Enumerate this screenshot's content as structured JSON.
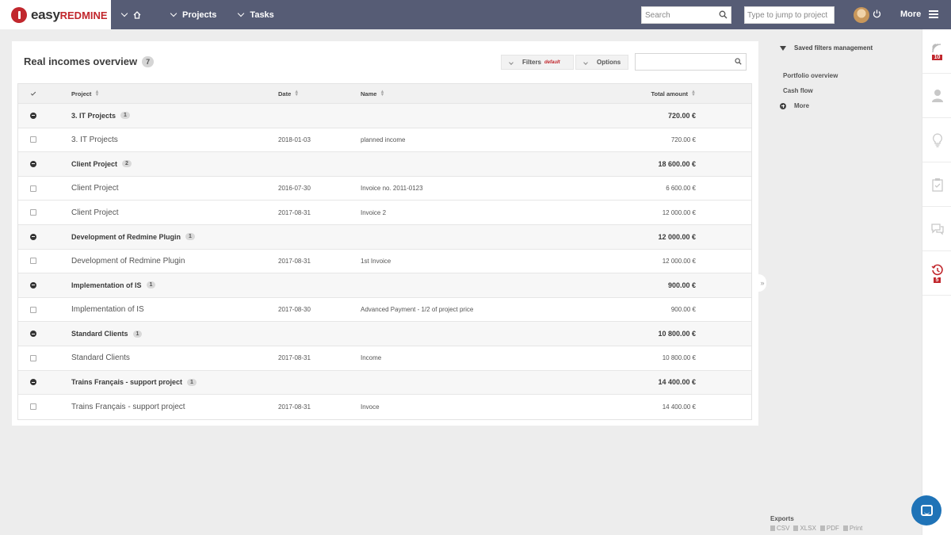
{
  "topbar": {
    "logo_easy": "easy",
    "logo_redmine": "REDMINE",
    "nav_projects": "Projects",
    "nav_tasks": "Tasks",
    "search_placeholder": "Search",
    "jump_placeholder": "Type to jump to project",
    "more_label": "More"
  },
  "main": {
    "title": "Real incomes overview",
    "count": "7",
    "filters_label": "Filters",
    "filters_default": "default",
    "options_label": "Options",
    "columns": {
      "project": "Project",
      "date": "Date",
      "name": "Name",
      "total_amount": "Total amount"
    },
    "groups": [
      {
        "label": "3. IT Projects",
        "count": "1",
        "total": "720.00 €",
        "rows": [
          {
            "project": "3. IT Projects",
            "date": "2018-01-03",
            "name": "planned income",
            "amount": "720.00 €"
          }
        ]
      },
      {
        "label": "Client Project",
        "count": "2",
        "total": "18 600.00 €",
        "rows": [
          {
            "project": "Client Project",
            "date": "2016-07-30",
            "name": "Invoice no. 2011-0123",
            "amount": "6 600.00 €"
          },
          {
            "project": "Client Project",
            "date": "2017-08-31",
            "name": "Invoice 2",
            "amount": "12 000.00 €"
          }
        ]
      },
      {
        "label": "Development of Redmine Plugin",
        "count": "1",
        "total": "12 000.00 €",
        "rows": [
          {
            "project": "Development of Redmine Plugin",
            "date": "2017-08-31",
            "name": "1st Invoice",
            "amount": "12 000.00 €"
          }
        ]
      },
      {
        "label": "Implementation of IS",
        "count": "1",
        "total": "900.00 €",
        "rows": [
          {
            "project": "Implementation of IS",
            "date": "2017-08-30",
            "name": "Advanced Payment - 1/2 of project price",
            "amount": "900.00 €"
          }
        ]
      },
      {
        "label": "Standard Clients",
        "count": "1",
        "total": "10 800.00 €",
        "rows": [
          {
            "project": "Standard Clients",
            "date": "2017-08-31",
            "name": "Income",
            "amount": "10 800.00 €"
          }
        ]
      },
      {
        "label": "Trains Français - support project",
        "count": "1",
        "total": "14 400.00 €",
        "rows": [
          {
            "project": "Trains Français - support project",
            "date": "2017-08-31",
            "name": "Invoce",
            "amount": "14 400.00 €"
          }
        ]
      }
    ]
  },
  "sidebar": {
    "saved_filters": "Saved filters management",
    "links": [
      "Portfolio overview",
      "Cash flow"
    ],
    "more": "More",
    "exports_title": "Exports",
    "export_formats": [
      "CSV",
      "XLSX",
      "PDF",
      "Print"
    ]
  },
  "rail": {
    "activity_badge": "10",
    "timer_badge": "5"
  },
  "colors": {
    "topbar": "#565c75",
    "brand_red": "#c1272d",
    "chat": "#1f73b7"
  }
}
